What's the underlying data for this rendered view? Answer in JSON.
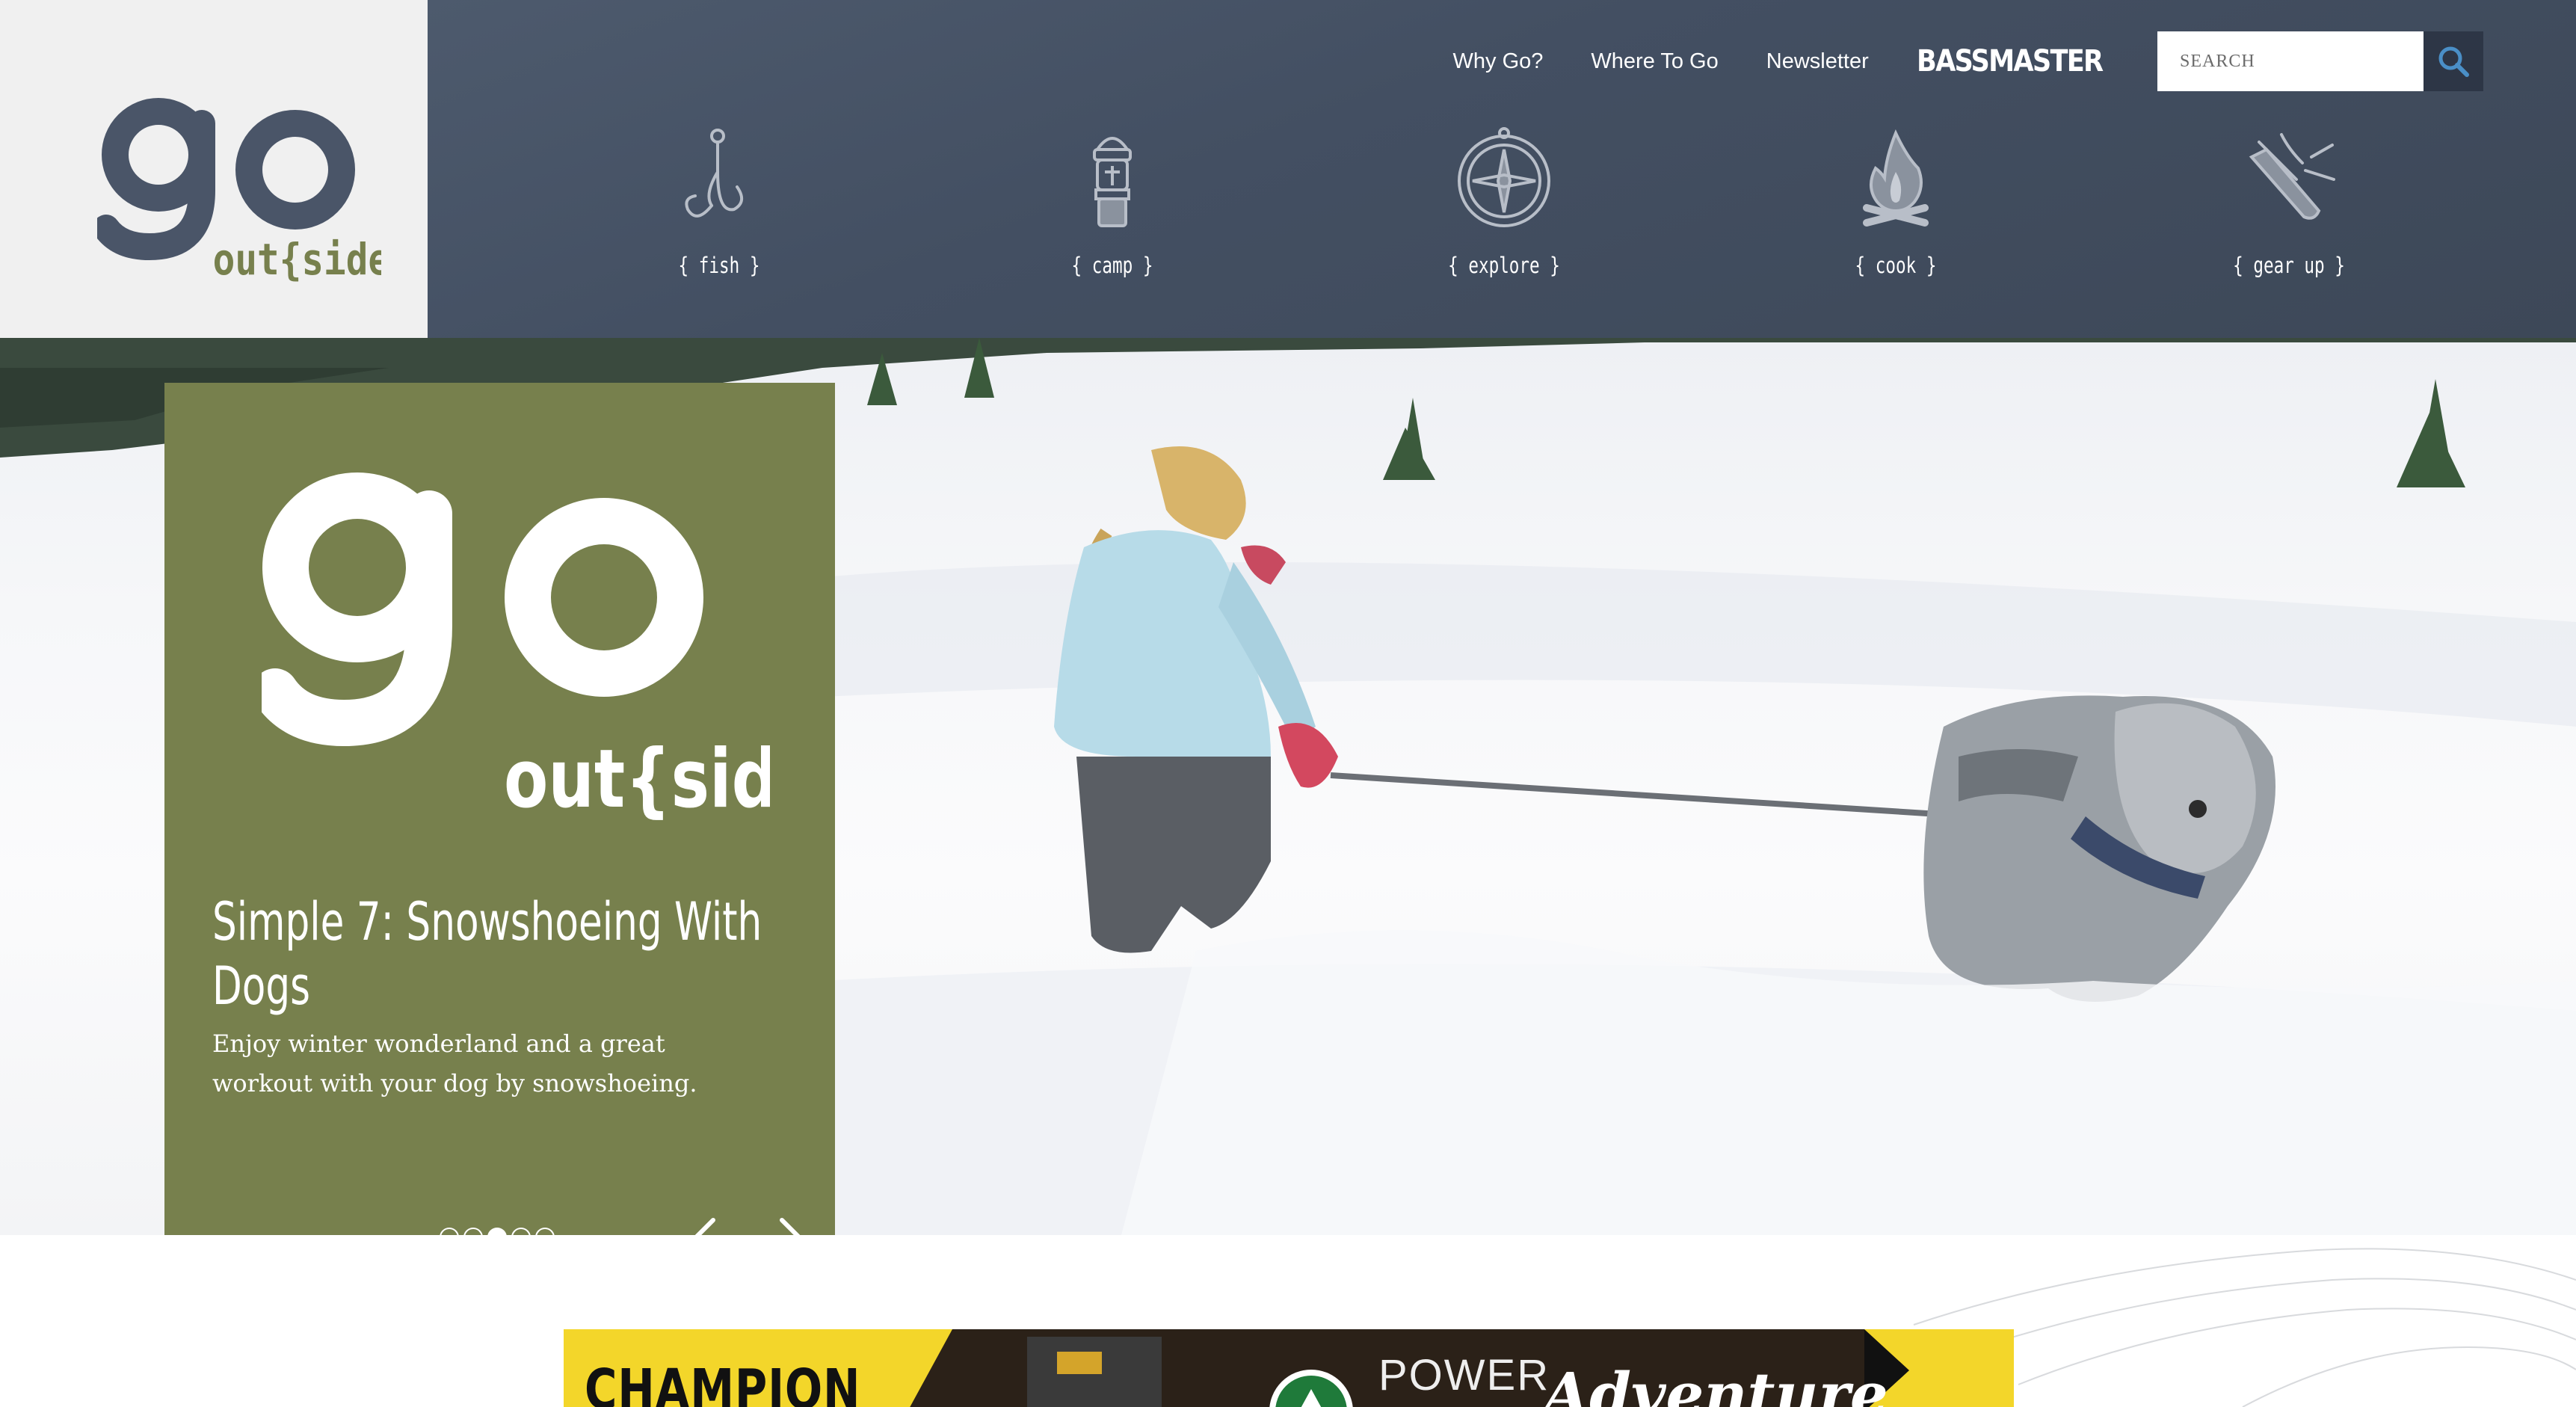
{
  "brand": {
    "logo_main": "go",
    "logo_sub": "out{side}",
    "logo_color_main": "#4a5568",
    "logo_color_sub": "#77804d"
  },
  "topnav": {
    "links": [
      "Why Go?",
      "Where To Go",
      "Newsletter"
    ],
    "partner": "BASSMASTER",
    "search_placeholder": "SEARCH"
  },
  "categories": [
    {
      "label": "{ fish }",
      "icon": "fish-hook-icon"
    },
    {
      "label": "{ camp }",
      "icon": "lantern-icon"
    },
    {
      "label": "{ explore }",
      "icon": "compass-icon"
    },
    {
      "label": "{ cook }",
      "icon": "campfire-icon"
    },
    {
      "label": "{ gear up }",
      "icon": "multitool-icon"
    }
  ],
  "hero": {
    "logo_main": "go",
    "logo_sub": "out{side}",
    "title": "Simple 7: Snowshoeing With Dogs",
    "description": "Enjoy winter wonderland and a great workout with your dog by snowshoeing.",
    "slides_total": 5,
    "active_slide": 3,
    "card_color": "#77804d"
  },
  "ad": {
    "brand": "CHAMPION",
    "headline_1": "POWER",
    "headline_2": "Adventure"
  },
  "colors": {
    "header_bg": "#455063",
    "search_btn_bg": "#2d3646",
    "search_icon": "#4a8fc7"
  }
}
